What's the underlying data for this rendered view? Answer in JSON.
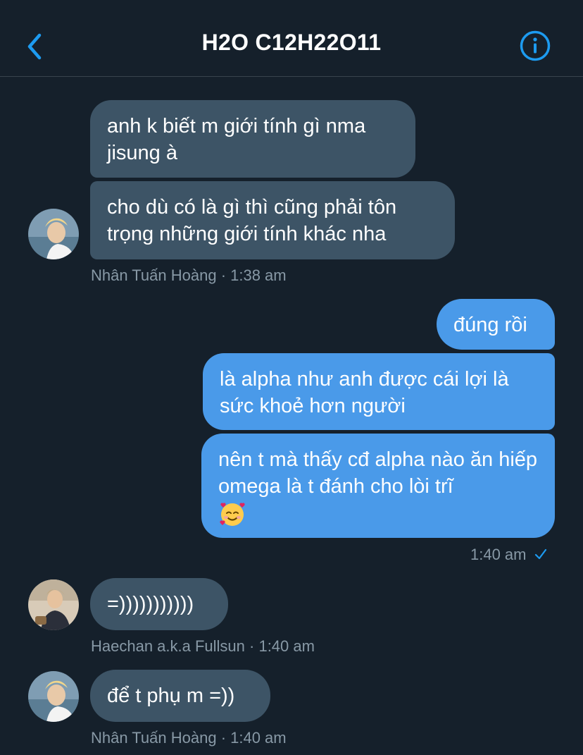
{
  "header": {
    "title": "H2O C12H22O11"
  },
  "messages": [
    {
      "text": "anh k biết m giới tính gì nma jisung à"
    },
    {
      "text": "cho dù có là gì thì cũng phải tôn trọng những giới tính khác nha"
    },
    {
      "text": "đúng rồi"
    },
    {
      "text": "là alpha như anh được cái lợi là sức khoẻ hơn người"
    },
    {
      "text": "nên t mà thấy cđ alpha nào ăn hiếp omega là t đánh cho lòi trĩ"
    },
    {
      "text": "=)))))))))))"
    },
    {
      "text": "để t phụ m =))"
    }
  ],
  "meta": {
    "m1": "Nhân Tuấn Hoàng · 1:38 am",
    "m2": "1:40 am",
    "m3": "Haechan a.k.a Fullsun · 1:40 am",
    "m4": "Nhân Tuấn Hoàng · 1:40 am"
  },
  "colors": {
    "background": "#15202b",
    "incoming_bubble": "#3d5466",
    "outgoing_bubble": "#4a9ae9",
    "accent": "#1d9bf0",
    "meta_text": "#8899a6"
  },
  "icons": {
    "back": "chevron-left-icon",
    "info": "info-circle-icon",
    "emoji": "smiling-face-with-hearts-emoji",
    "read": "checkmark-icon"
  }
}
